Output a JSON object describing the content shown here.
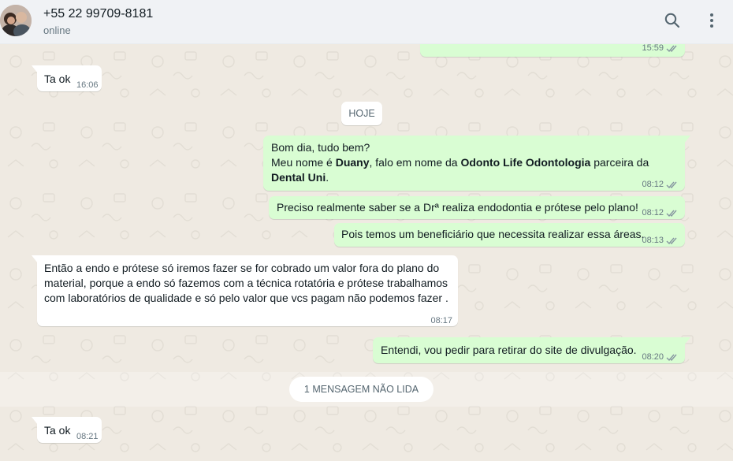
{
  "header": {
    "contact_name": "+55 22 99709-8181",
    "status": "online",
    "search_icon": "search-icon",
    "menu_icon": "more-vertical-icon"
  },
  "colors": {
    "chat_bg": "#efeae2",
    "incoming_bubble": "#ffffff",
    "outgoing_bubble": "#d9fdd3",
    "read_ticks": "#8696a0"
  },
  "messages": {
    "prev_out_time": "15:59",
    "m1": {
      "text": "Ta ok",
      "time": "16:06"
    },
    "day_label": "HOJE",
    "m2": {
      "line1": "Bom dia, tudo bem?",
      "line2_a": "Meu nome é ",
      "line2_b": "Duany",
      "line2_c": ", falo em nome da ",
      "line2_d": "Odonto Life Odontologia",
      "line2_e": " parceira da",
      "line3_a": "Dental Uni",
      "line3_b": ".",
      "time": "08:12"
    },
    "m3": {
      "text": "Preciso realmente saber se a Drª realiza endodontia e prótese pelo plano!",
      "time": "08:12"
    },
    "m4": {
      "text": "Pois temos um beneficiário que necessita realizar essa áreas.",
      "time": "08:13"
    },
    "m5": {
      "line1": "Então a endo e prótese só iremos fazer se for cobrado um valor fora do plano do",
      "line2": "material, porque a endo só fazemos com a técnica rotatória e prótese trabalhamos",
      "line3": "com laboratórios de qualidade e só pelo valor que vcs pagam não podemos fazer .",
      "time": "08:17"
    },
    "m6": {
      "text": "Entendi, vou pedir para retirar do site de divulgação.",
      "time": "08:20"
    },
    "unread_label": "1 MENSAGEM NÃO LIDA",
    "m7": {
      "text": "Ta ok",
      "time": "08:21"
    }
  }
}
